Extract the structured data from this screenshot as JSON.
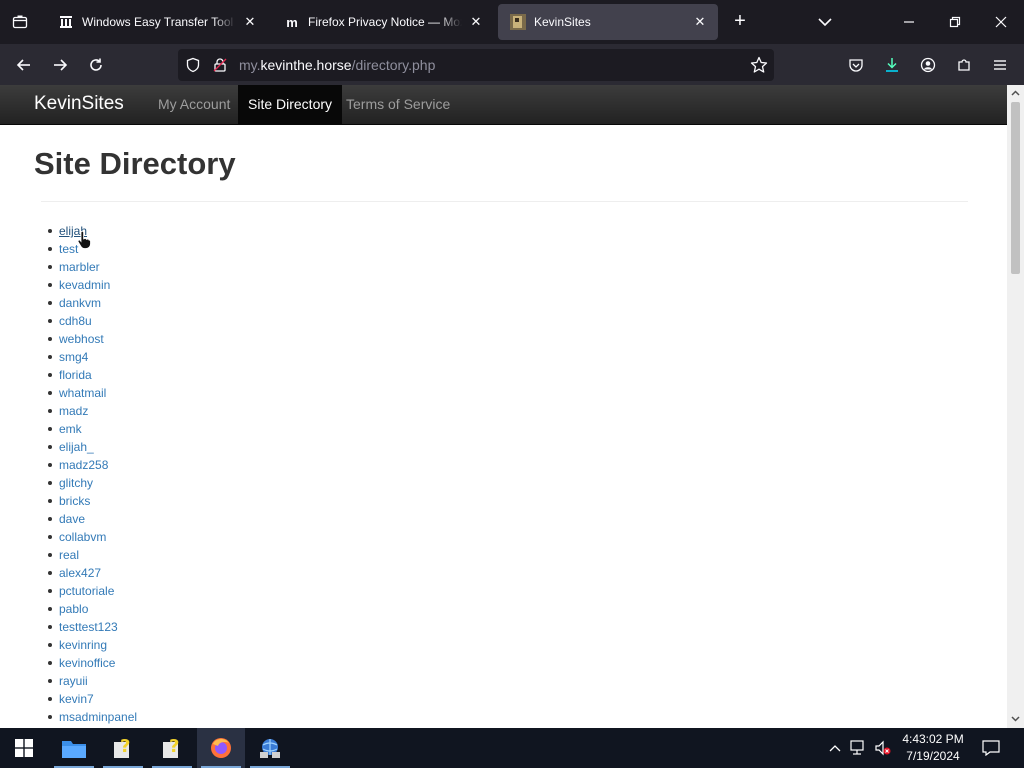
{
  "browser": {
    "tabs": [
      {
        "title": "Windows Easy Transfer Tool : Microsoft",
        "favicon": "archive-org-icon",
        "active": false
      },
      {
        "title": "Firefox Privacy Notice — Mozilla",
        "favicon": "mozilla-m-icon",
        "active": false
      },
      {
        "title": "KevinSites",
        "favicon": "kevinsites-favicon",
        "active": true
      }
    ],
    "url": {
      "prefix": "my.",
      "host": "kevinthe.horse",
      "path": "/directory.php"
    }
  },
  "site": {
    "brand": "KevinSites",
    "nav": [
      {
        "label": "My Account",
        "active": false
      },
      {
        "label": "Site Directory",
        "active": true
      },
      {
        "label": "Terms of Service",
        "active": false
      }
    ],
    "page_title": "Site Directory",
    "directory": [
      "elijah",
      "test",
      "marbler",
      "kevadmin",
      "dankvm",
      "cdh8u",
      "webhost",
      "smg4",
      "florida",
      "whatmail",
      "madz",
      "emk",
      "elijah_",
      "madz258",
      "glitchy",
      "bricks",
      "dave",
      "collabvm",
      "real",
      "alex427",
      "pctutoriale",
      "pablo",
      "testtest123",
      "kevinring",
      "kevinoffice",
      "rayuii",
      "kevin7",
      "msadminpanel"
    ],
    "hovered_item": "elijah"
  },
  "taskbar": {
    "time": "4:43:02 PM",
    "date": "7/19/2024"
  },
  "colors": {
    "link": "#337ab7",
    "navbar_dark": "#222222",
    "browser_chrome": "#1c1b22",
    "taskbar": "#101520"
  }
}
